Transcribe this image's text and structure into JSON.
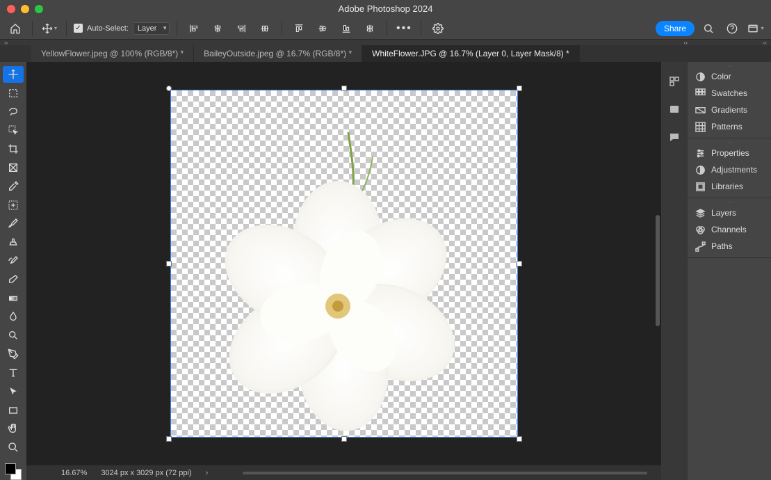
{
  "app_title": "Adobe Photoshop 2024",
  "optionsbar": {
    "auto_select_label": "Auto-Select:",
    "auto_select_checked": true,
    "select_scope": "Layer",
    "share_label": "Share"
  },
  "document_tabs": [
    {
      "label": "YellowFlower.jpeg @ 100% (RGB/8*) *",
      "active": false
    },
    {
      "label": "BaileyOutside.jpeg @ 16.7% (RGB/8*) *",
      "active": false
    },
    {
      "label": "WhiteFlower.JPG @ 16.7% (Layer 0, Layer Mask/8) *",
      "active": true
    }
  ],
  "left_tools": [
    "move-tool",
    "rectangular-marquee-tool",
    "lasso-tool",
    "object-selection-tool",
    "crop-tool",
    "frame-tool",
    "eyedropper-tool",
    "spot-healing-brush-tool",
    "brush-tool",
    "clone-stamp-tool",
    "history-brush-tool",
    "eraser-tool",
    "gradient-tool",
    "blur-tool",
    "dodge-tool",
    "pen-tool",
    "type-tool",
    "path-selection-tool",
    "rectangle-tool",
    "hand-tool",
    "zoom-tool"
  ],
  "right_strip_icons": [
    "panel-icon-1",
    "panel-icon-2",
    "panel-icon-3"
  ],
  "right_panel_groups": [
    {
      "items": [
        {
          "icon": "color",
          "label": "Color"
        },
        {
          "icon": "swatches",
          "label": "Swatches"
        },
        {
          "icon": "gradients",
          "label": "Gradients"
        },
        {
          "icon": "patterns",
          "label": "Patterns"
        }
      ]
    },
    {
      "items": [
        {
          "icon": "properties",
          "label": "Properties"
        },
        {
          "icon": "adjustments",
          "label": "Adjustments"
        },
        {
          "icon": "libraries",
          "label": "Libraries"
        }
      ]
    },
    {
      "items": [
        {
          "icon": "layers",
          "label": "Layers"
        },
        {
          "icon": "channels",
          "label": "Channels"
        },
        {
          "icon": "paths",
          "label": "Paths"
        }
      ]
    }
  ],
  "status": {
    "zoom": "16.67%",
    "doc_info": "3024 px x 3029 px (72 ppi)"
  },
  "canvas": {
    "image_description": "white flower on transparent background",
    "selection_active": true
  }
}
